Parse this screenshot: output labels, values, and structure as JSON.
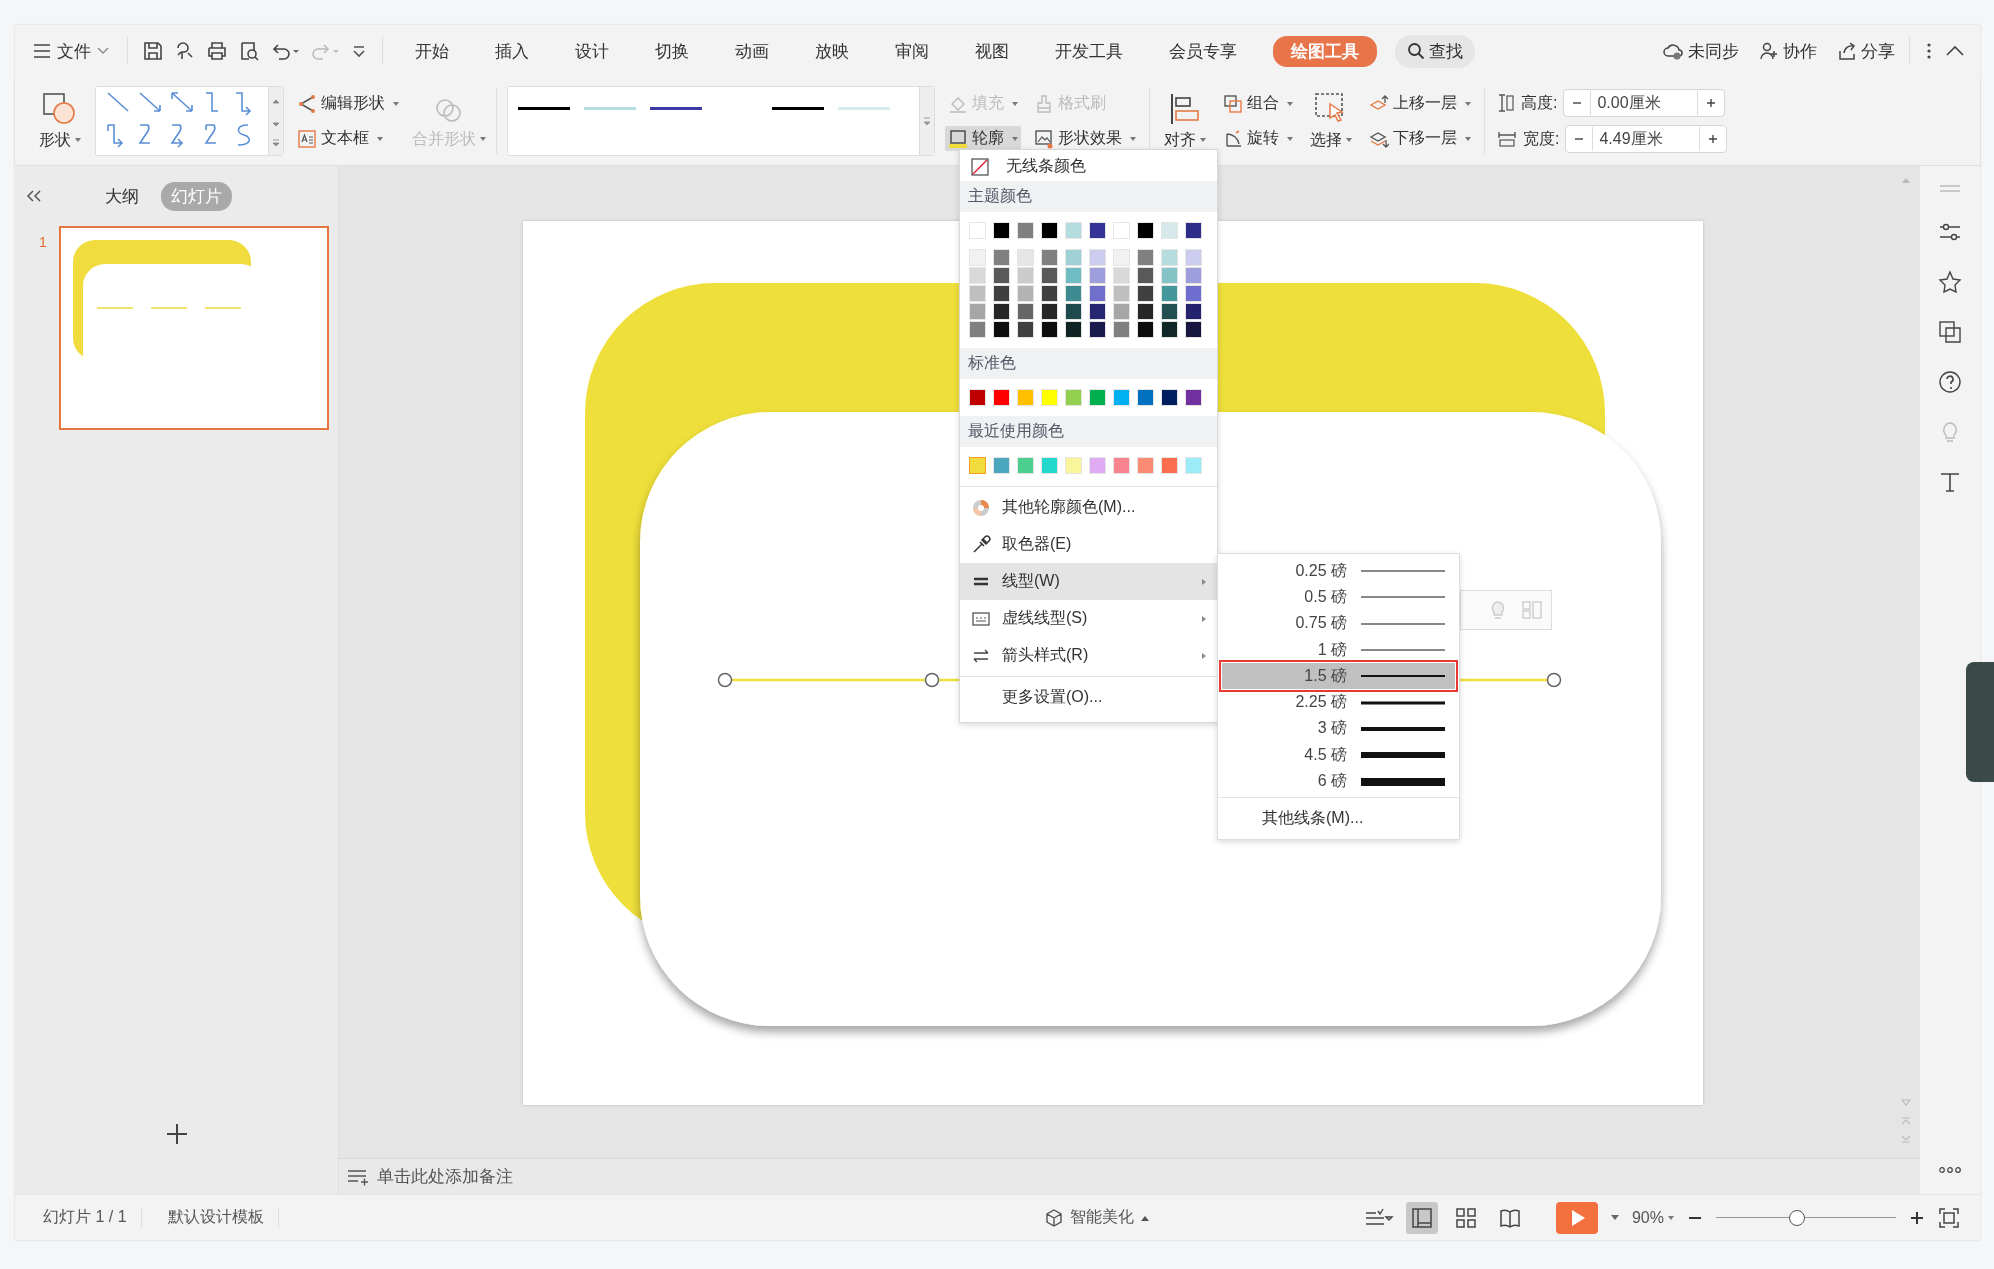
{
  "menu_bar": {
    "file_menu": "文件",
    "tabs": [
      {
        "label": "开始",
        "selected": false
      },
      {
        "label": "插入",
        "selected": false
      },
      {
        "label": "设计",
        "selected": false
      },
      {
        "label": "切换",
        "selected": false
      },
      {
        "label": "动画",
        "selected": false
      },
      {
        "label": "放映",
        "selected": false
      },
      {
        "label": "审阅",
        "selected": false
      },
      {
        "label": "视图",
        "selected": false
      },
      {
        "label": "开发工具",
        "selected": false
      },
      {
        "label": "会员专享",
        "selected": false
      },
      {
        "label": "绘图工具",
        "selected": true
      }
    ],
    "search": "查找",
    "actions": [
      {
        "label": "未同步",
        "kind": "sync"
      },
      {
        "label": "协作",
        "kind": "collab"
      },
      {
        "label": "分享",
        "kind": "share"
      }
    ]
  },
  "ribbon": {
    "shape": "形状",
    "edit_shape": "编辑形状",
    "text_box": "文本框",
    "merge_shape": {
      "label": "合并形状",
      "disabled": true
    },
    "style_gallery": [
      {
        "color": "#000000"
      },
      {
        "color": "#b4dde0"
      },
      {
        "color": "#3b3ba8"
      },
      {
        "color": "#000000"
      },
      {
        "color": "#d6ecee"
      }
    ],
    "fill": {
      "label": "填充",
      "disabled": true
    },
    "format_painter": {
      "label": "格式刷",
      "disabled": true
    },
    "outline": {
      "label": "轮廓",
      "pressed": true
    },
    "shape_effects": "形状效果",
    "align": "对齐",
    "group": "组合",
    "rotate": "旋转",
    "select": "选择",
    "bring_forward": "上移一层",
    "send_backward": "下移一层",
    "height": {
      "label": "高度:",
      "value": "0.00厘米"
    },
    "width": {
      "label": "宽度:",
      "value": "4.49厘米"
    }
  },
  "slide_panel": {
    "tabs": [
      {
        "label": "大纲",
        "selected": false
      },
      {
        "label": "幻灯片",
        "selected": true
      }
    ],
    "slides": [
      {
        "number": "1",
        "selected": true
      }
    ]
  },
  "outline_menu": {
    "no_color": "无线条颜色",
    "theme_label": "主题颜色",
    "theme_top": [
      {
        "color": "#ffffff"
      },
      {
        "color": "#000000"
      },
      {
        "color": "#808080"
      },
      {
        "color": "#000000"
      },
      {
        "color": "#b4dde0"
      },
      {
        "color": "#333399"
      },
      {
        "color": "#ffffff"
      },
      {
        "color": "#000000"
      },
      {
        "color": "#d6e8ea"
      },
      {
        "color": "#2e2e8a"
      }
    ],
    "theme_shades": [
      [
        {
          "color": "#f2f2f2"
        },
        {
          "color": "#808080"
        },
        {
          "color": "#e6e6e6"
        },
        {
          "color": "#808080"
        },
        {
          "color": "#9fd0d5"
        },
        {
          "color": "#ccccee"
        },
        {
          "color": "#f2f2f2"
        },
        {
          "color": "#808080"
        },
        {
          "color": "#b6dcde"
        },
        {
          "color": "#ccccee"
        }
      ],
      [
        {
          "color": "#d9d9d9"
        },
        {
          "color": "#595959"
        },
        {
          "color": "#cccccc"
        },
        {
          "color": "#595959"
        },
        {
          "color": "#6fbcc3"
        },
        {
          "color": "#9e9edc"
        },
        {
          "color": "#d9d9d9"
        },
        {
          "color": "#595959"
        },
        {
          "color": "#86c3c6"
        },
        {
          "color": "#9e9edc"
        }
      ],
      [
        {
          "color": "#bfbfbf"
        },
        {
          "color": "#404040"
        },
        {
          "color": "#b3b3b3"
        },
        {
          "color": "#404040"
        },
        {
          "color": "#3d8a90"
        },
        {
          "color": "#7070cc"
        },
        {
          "color": "#bfbfbf"
        },
        {
          "color": "#404040"
        },
        {
          "color": "#44989b"
        },
        {
          "color": "#6e6ecf"
        }
      ],
      [
        {
          "color": "#a6a6a6"
        },
        {
          "color": "#262626"
        },
        {
          "color": "#666666"
        },
        {
          "color": "#262626"
        },
        {
          "color": "#1f4a4d"
        },
        {
          "color": "#262673"
        },
        {
          "color": "#a6a6a6"
        },
        {
          "color": "#262626"
        },
        {
          "color": "#225052"
        },
        {
          "color": "#22226e"
        }
      ],
      [
        {
          "color": "#808080"
        },
        {
          "color": "#0d0d0d"
        },
        {
          "color": "#404040"
        },
        {
          "color": "#0d0d0d"
        },
        {
          "color": "#0f2324"
        },
        {
          "color": "#1a1a4d"
        },
        {
          "color": "#808080"
        },
        {
          "color": "#0d0d0d"
        },
        {
          "color": "#112829"
        },
        {
          "color": "#161640"
        }
      ]
    ],
    "standard_label": "标准色",
    "standard": [
      {
        "color": "#c00000"
      },
      {
        "color": "#ff0000"
      },
      {
        "color": "#ffc000"
      },
      {
        "color": "#ffff00"
      },
      {
        "color": "#92d050"
      },
      {
        "color": "#00b050"
      },
      {
        "color": "#00b0f0"
      },
      {
        "color": "#0070c0"
      },
      {
        "color": "#002060"
      },
      {
        "color": "#7030a0"
      }
    ],
    "recent_label": "最近使用颜色",
    "recent": [
      {
        "color": "#f0dc3c",
        "selected": true
      },
      {
        "color": "#4ba6bf",
        "selected": false
      },
      {
        "color": "#4ccf8e",
        "selected": false
      },
      {
        "color": "#22d9cc",
        "selected": false
      },
      {
        "color": "#f9f59a",
        "selected": false
      },
      {
        "color": "#e1aaf5",
        "selected": false
      },
      {
        "color": "#f9838e",
        "selected": false
      },
      {
        "color": "#fc8b76",
        "selected": false
      },
      {
        "color": "#fd6e50",
        "selected": false
      },
      {
        "color": "#9cecf7",
        "selected": false
      }
    ],
    "items": [
      {
        "label": "其他轮廓颜色(M)...",
        "kind": "palette",
        "has_submenu": false,
        "selected": false
      },
      {
        "label": "取色器(E)",
        "kind": "eyedropper",
        "has_submenu": false,
        "selected": false
      },
      {
        "label": "线型(W)",
        "kind": "weight",
        "has_submenu": true,
        "selected": true
      },
      {
        "label": "虚线线型(S)",
        "kind": "dash",
        "has_submenu": true,
        "selected": false
      },
      {
        "label": "箭头样式(R)",
        "kind": "arrow",
        "has_submenu": true,
        "selected": false
      },
      {
        "label": "更多设置(O)...",
        "kind": "more",
        "has_submenu": false,
        "selected": false
      }
    ]
  },
  "line_weight_menu": {
    "items": [
      {
        "label": "0.25 磅",
        "selected": false
      },
      {
        "label": "0.5 磅",
        "selected": false
      },
      {
        "label": "0.75 磅",
        "selected": false
      },
      {
        "label": "1 磅",
        "selected": false
      },
      {
        "label": "1.5 磅",
        "selected": true
      },
      {
        "label": "2.25 磅",
        "selected": false
      },
      {
        "label": "3 磅",
        "selected": false
      },
      {
        "label": "4.5 磅",
        "selected": false
      },
      {
        "label": "6 磅",
        "selected": false
      }
    ],
    "more": "其他线条(M)..."
  },
  "notes": {
    "prompt": "单击此处添加备注"
  },
  "status_bar": {
    "slide_count": "幻灯片 1 / 1",
    "template": "默认设计模板",
    "beautify": "智能美化",
    "views": [
      {
        "kind": "normal",
        "selected": true
      },
      {
        "kind": "sorter",
        "selected": false
      },
      {
        "kind": "reading",
        "selected": false
      }
    ],
    "zoom": "90%",
    "zoom_slider": {
      "level": 0.45
    }
  }
}
